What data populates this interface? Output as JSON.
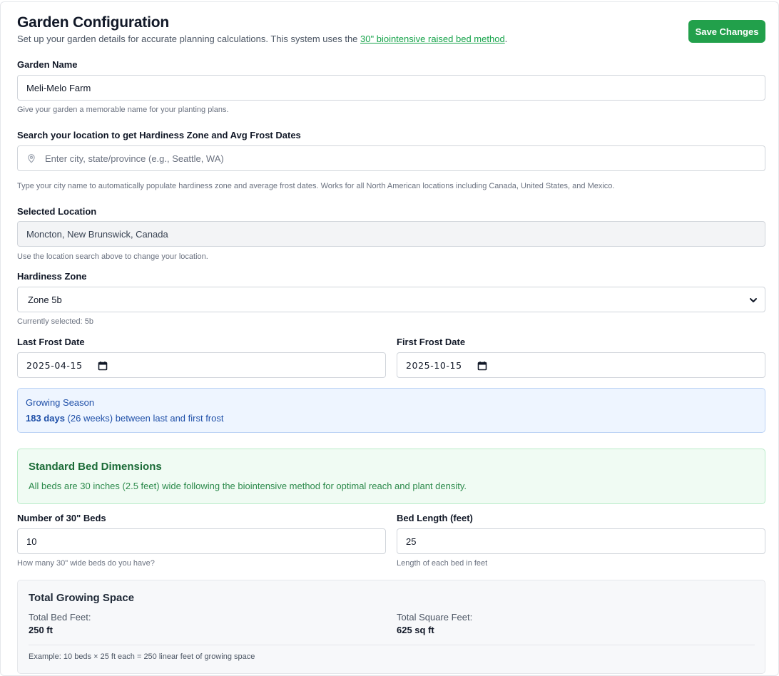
{
  "header": {
    "title": "Garden Configuration",
    "subtitle_prefix": "Set up your garden details for accurate planning calculations. This system uses the ",
    "subtitle_link": "30\" biointensive raised bed method",
    "subtitle_suffix": ".",
    "save_label": "Save Changes"
  },
  "garden_name": {
    "label": "Garden Name",
    "value": "Meli-Melo Farm",
    "help": "Give your garden a memorable name for your planting plans."
  },
  "location_search": {
    "label": "Search your location to get Hardiness Zone and Avg Frost Dates",
    "placeholder": "Enter city, state/province (e.g., Seattle, WA)",
    "help": "Type your city name to automatically populate hardiness zone and average frost dates. Works for all North American locations including Canada, United States, and Mexico."
  },
  "selected_location": {
    "label": "Selected Location",
    "value": "Moncton, New Brunswick, Canada",
    "help": "Use the location search above to change your location."
  },
  "hardiness_zone": {
    "label": "Hardiness Zone",
    "value": "Zone 5b",
    "help": "Currently selected: 5b"
  },
  "frost": {
    "last_label": "Last Frost Date",
    "last_value": "2025-04-15",
    "first_label": "First Frost Date",
    "first_value": "2025-10-15"
  },
  "growing_season": {
    "title": "Growing Season",
    "days": "183 days",
    "detail": " (26 weeks) between last and first frost"
  },
  "bed_dimensions": {
    "title": "Standard Bed Dimensions",
    "text": "All beds are 30 inches (2.5 feet) wide following the biointensive method for optimal reach and plant density."
  },
  "beds": {
    "count_label": "Number of 30\" Beds",
    "count_value": "10",
    "count_help": "How many 30\" wide beds do you have?",
    "length_label": "Bed Length (feet)",
    "length_value": "25",
    "length_help": "Length of each bed in feet"
  },
  "total": {
    "title": "Total Growing Space",
    "bed_feet_label": "Total Bed Feet:",
    "bed_feet_value": "250 ft",
    "square_feet_label": "Total Square Feet:",
    "square_feet_value": "625 sq ft",
    "example": "Example: 10 beds × 25 ft each = 250 linear feet of growing space"
  },
  "icons": {
    "location": "map-pin-icon",
    "select": "chevron-down-icon",
    "date": "calendar-icon"
  },
  "colors": {
    "primary": "#22a04b",
    "link": "#16a34a",
    "info_text": "#1e4fa8",
    "info_bg": "#eef5ff",
    "success_bg": "#f0fbf3",
    "success_text": "#1b6b37"
  }
}
